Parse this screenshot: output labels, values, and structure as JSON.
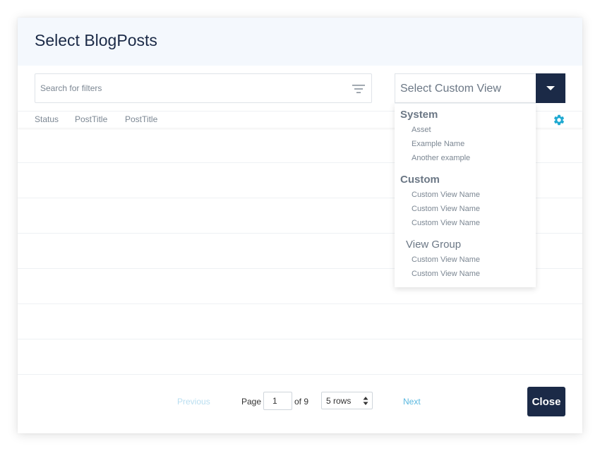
{
  "modal": {
    "title": "Select BlogPosts"
  },
  "search": {
    "placeholder": "Search for filters"
  },
  "custom_view": {
    "label": "Select Custom View"
  },
  "columns": [
    "Status",
    "PostTitle",
    "PostTitle"
  ],
  "dropdown": {
    "system_label": "System",
    "system_items": [
      "Asset",
      "Example Name",
      "Another example"
    ],
    "custom_label": "Custom",
    "custom_items": [
      "Custom View Name",
      "Custom View Name",
      "Custom View Name"
    ],
    "view_group_label": "View Group",
    "view_group_items": [
      "Custom View Name",
      "Custom View Name"
    ]
  },
  "pagination": {
    "previous": "Previous",
    "page_label": "Page",
    "current_page": "1",
    "of_label": "of 9",
    "rows_label": "5 rows",
    "next": "Next"
  },
  "close_label": "Close",
  "colors": {
    "navy": "#1b2a47",
    "accent": "#1fa9d1",
    "header_bg": "#f4f8fd"
  },
  "icons": {
    "filter": "filter-icon",
    "gear": "gear-icon",
    "caret": "caret-down-icon"
  }
}
